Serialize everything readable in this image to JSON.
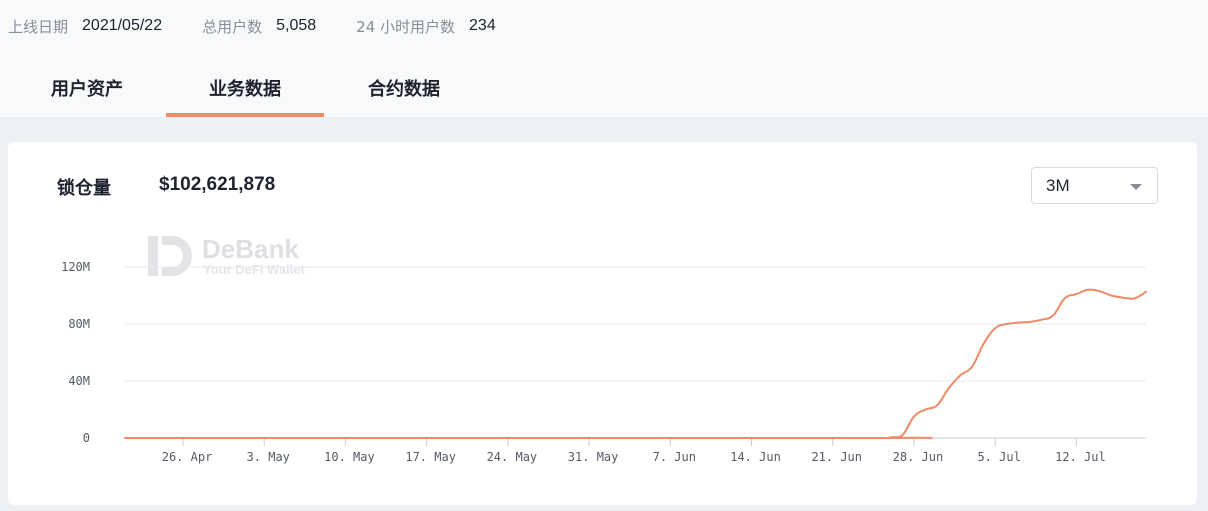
{
  "stats": {
    "launch_label": "上线日期",
    "launch_value": "2021/05/22",
    "users_label": "总用户数",
    "users_value": "5,058",
    "users24_label": "24 小时用户数",
    "users24_value": "234"
  },
  "tabs": [
    {
      "label": "用户资产",
      "active": false
    },
    {
      "label": "业务数据",
      "active": true
    },
    {
      "label": "合约数据",
      "active": false
    }
  ],
  "metric": {
    "label": "锁仓量",
    "value": "$102,621,878"
  },
  "range_select": {
    "value": "3M"
  },
  "watermark": {
    "brand": "DeBank",
    "tagline": "Your DeFi Wallet"
  },
  "colors": {
    "accent": "#ef8a64",
    "line": "#f08a65"
  },
  "chart_data": {
    "type": "line",
    "title": "",
    "xlabel": "",
    "ylabel": "",
    "ylim": [
      0,
      120000000
    ],
    "yticks": [
      "0",
      "40M",
      "80M",
      "120M"
    ],
    "yticks_values": [
      0,
      40000000,
      80000000,
      120000000
    ],
    "xticks": [
      "26. Apr",
      "3. May",
      "10. May",
      "17. May",
      "24. May",
      "31. May",
      "7. Jun",
      "14. Jun",
      "21. Jun",
      "28. Jun",
      "5. Jul",
      "12. Jul"
    ],
    "xticks_day": [
      5,
      12,
      19,
      26,
      33,
      40,
      47,
      54,
      61,
      68,
      75,
      82
    ],
    "x_day_range": [
      0,
      88
    ],
    "grid": true,
    "series": [
      {
        "x": [
          "21. Apr",
          "23. Jun",
          "26. Jun",
          "27. Jun",
          "28. Jun",
          "29. Jun",
          "30. Jun",
          "1. Jul",
          "2. Jul",
          "3. Jul",
          "4. Jul",
          "5. Jul",
          "6. Jul",
          "7. Jul",
          "8. Jul",
          "9. Jul",
          "10. Jul",
          "11. Jul",
          "12. Jul",
          "13. Jul",
          "14. Jul",
          "15. Jul",
          "16. Jul",
          "17. Jul",
          "18. Jul"
        ],
        "x_day": [
          0,
          63,
          66,
          67,
          68,
          69,
          70,
          71,
          72,
          73,
          74,
          75,
          76,
          77,
          78,
          79,
          80,
          81,
          82,
          83,
          84,
          85,
          86,
          87,
          88
        ],
        "values": [
          0,
          0,
          500000,
          2000000,
          15000000,
          20000000,
          23000000,
          35000000,
          44000000,
          50000000,
          66000000,
          77000000,
          80000000,
          81000000,
          81500000,
          83000000,
          86000000,
          98000000,
          101000000,
          104000000,
          103000000,
          100000000,
          98500000,
          98000000,
          102600000
        ]
      }
    ]
  }
}
